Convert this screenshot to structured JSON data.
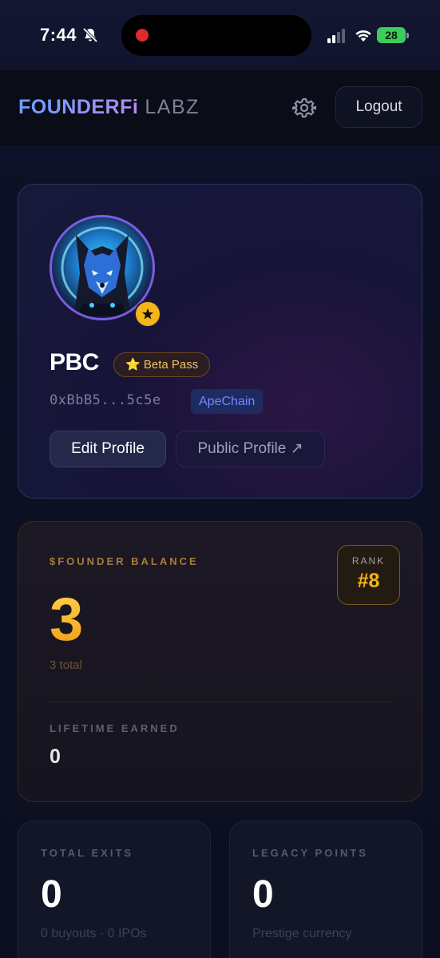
{
  "status_bar": {
    "time": "7:44",
    "battery": "28"
  },
  "header": {
    "brand_primary": "FOUNDERFi",
    "brand_secondary": "LABZ",
    "logout_label": "Logout"
  },
  "profile": {
    "username": "PBC",
    "badge_icon": "star-icon",
    "beta_pass_label": "Beta Pass",
    "beta_pass_icon": "⭐",
    "wallet_address": "0xBbB5...5c5e",
    "chain": "ApeChain",
    "edit_profile_label": "Edit Profile",
    "public_profile_label": "Public Profile ↗"
  },
  "balance": {
    "label": "$FOUNDER BALANCE",
    "value": "3",
    "subtext": "3 total",
    "rank_label": "RANK",
    "rank_value": "#8",
    "lifetime_label": "LIFETIME EARNED",
    "lifetime_value": "0"
  },
  "stats": [
    {
      "label": "TOTAL EXITS",
      "value": "0",
      "subtext": "0 buyouts · 0 IPOs"
    },
    {
      "label": "LEGACY POINTS",
      "value": "0",
      "subtext": "Prestige currency"
    }
  ],
  "colors": {
    "accent_gold": "#f4b41a",
    "accent_blue": "#6f8bff",
    "brand_gradient_start": "#6aa0ff",
    "brand_gradient_end": "#b58bf0"
  }
}
